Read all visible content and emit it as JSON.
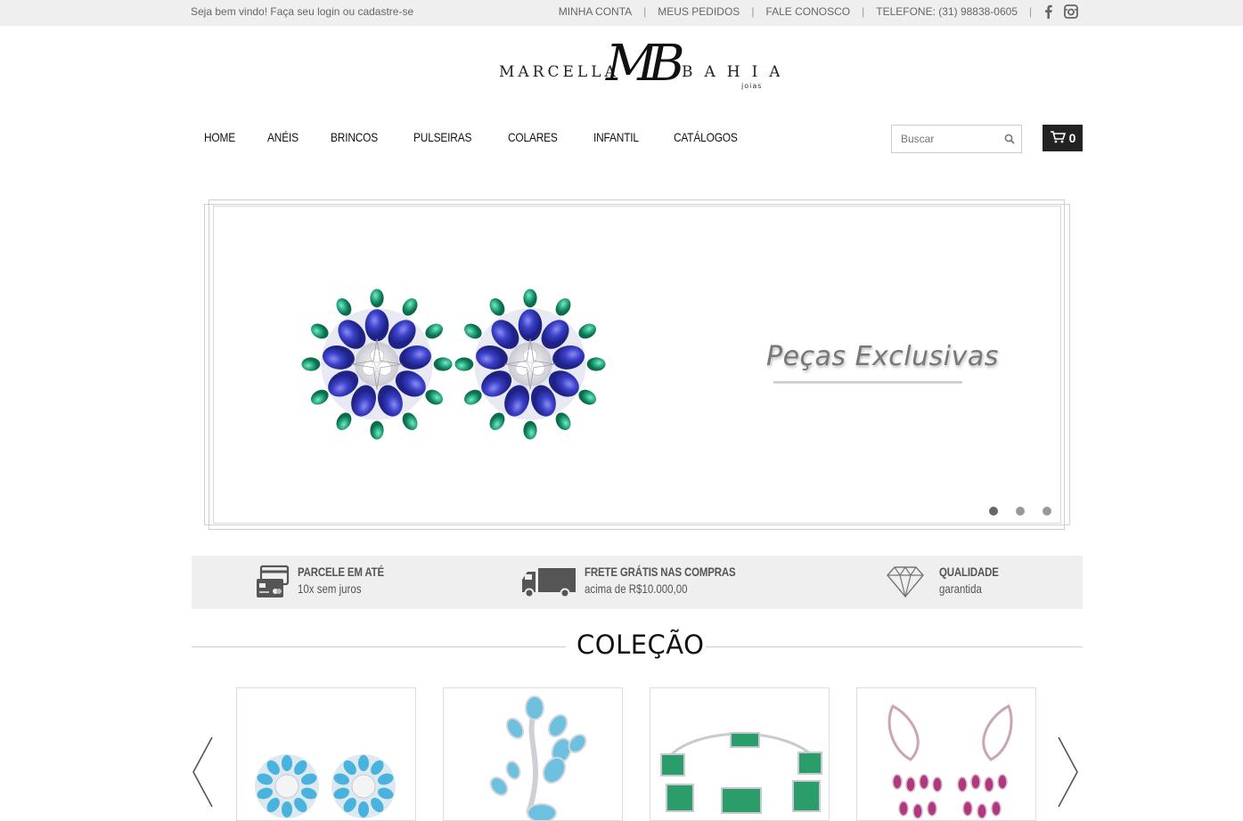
{
  "topbar": {
    "welcome": "Seja bem vindo! Faça seu login ou cadastre-se",
    "links": [
      "MINHA CONTA",
      "MEUS PEDIDOS",
      "FALE CONOSCO",
      "TELEFONE: (31) 98838-0605"
    ],
    "social": [
      "facebook-icon",
      "instagram-icon"
    ]
  },
  "logo": {
    "left": "MARCELLA",
    "right": "BAHIA",
    "monogram": "MB",
    "sub": "joias"
  },
  "nav": {
    "items": [
      "HOME",
      "ANÉIS",
      "BRINCOS",
      "PULSEIRAS",
      "COLARES",
      "INFANTIL",
      "CATÁLOGOS"
    ]
  },
  "search": {
    "placeholder": "Buscar"
  },
  "cart": {
    "count": "0"
  },
  "banner": {
    "caption": "Peças Exclusivas",
    "slides": 3,
    "active_slide": 1
  },
  "features": [
    {
      "icon": "credit-card-icon",
      "title": "PARCELE EM ATÉ",
      "subtitle": "10x sem juros"
    },
    {
      "icon": "truck-icon",
      "title": "FRETE GRÁTIS NAS COMPRAS",
      "subtitle": "acima de R$10.000,00"
    },
    {
      "icon": "diamond-icon",
      "title": "QUALIDADE",
      "subtitle": "garantida"
    }
  ],
  "collection": {
    "title": "COLEÇÃO"
  },
  "colors": {
    "topbar_bg": "#efefef",
    "cart_bg": "#222222",
    "sapphire": "#3a3fc8",
    "emerald": "#1fa37a",
    "turquoise": "#49b3dd",
    "amethyst": "#b0387e"
  }
}
